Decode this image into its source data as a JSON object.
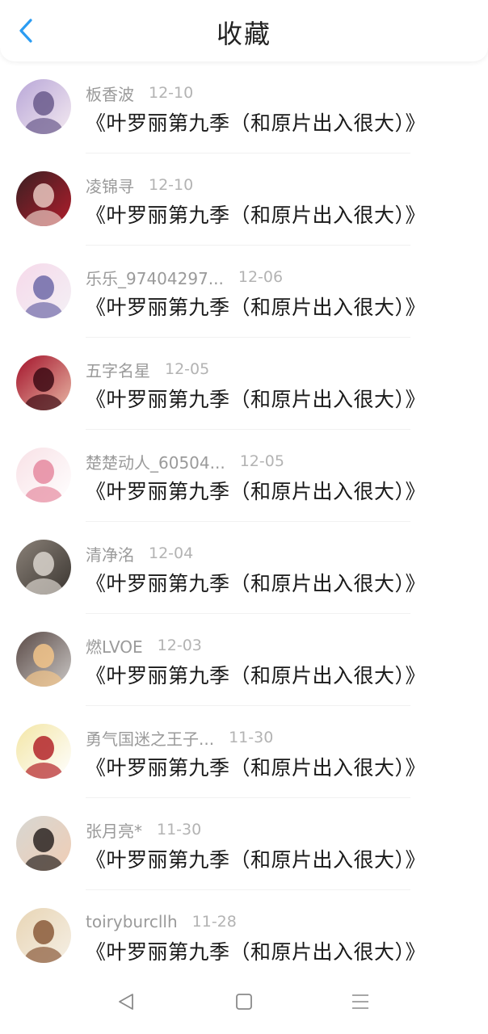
{
  "header": {
    "title": "收藏",
    "back_icon": "chevron-left-icon",
    "accent_color": "#2b9cf2"
  },
  "favorites": [
    {
      "username": "板香波",
      "date": "12-10",
      "title": "《叶罗丽第九季（和原片出入很大）》",
      "avatar_colors": [
        "#b9a7d8",
        "#6a5a8c",
        "#f3e9f0"
      ]
    },
    {
      "username": "凌锦寻",
      "date": "12-10",
      "title": "《叶罗丽第九季（和原片出入很大）》",
      "avatar_colors": [
        "#3a1f22",
        "#e8c7c0",
        "#b01e2c"
      ]
    },
    {
      "username": "乐乐_97404297...",
      "date": "12-06",
      "title": "《叶罗丽第九季（和原片出入很大）》",
      "avatar_colors": [
        "#f6d9ea",
        "#6f6aa8",
        "#f3f0f5"
      ]
    },
    {
      "username": "五字名星",
      "date": "12-05",
      "title": "《叶罗丽第九季（和原片出入很大）》",
      "avatar_colors": [
        "#a3122a",
        "#3d0b14",
        "#e8b6a4"
      ]
    },
    {
      "username": "楚楚动人_60504...",
      "date": "12-05",
      "title": "《叶罗丽第九季（和原片出入很大）》",
      "avatar_colors": [
        "#f8e1e6",
        "#e58aa0",
        "#ffffff"
      ]
    },
    {
      "username": "清净洺",
      "date": "12-04",
      "title": "《叶罗丽第九季（和原片出入很大）》",
      "avatar_colors": [
        "#8a8178",
        "#d9d3cc",
        "#3b3631"
      ]
    },
    {
      "username": "燃LVOE",
      "date": "12-03",
      "title": "《叶罗丽第九季（和原片出入很大）》",
      "avatar_colors": [
        "#5a4a46",
        "#f2c48a",
        "#c9c6c4"
      ]
    },
    {
      "username": "勇气国迷之王子...",
      "date": "11-30",
      "title": "《叶罗丽第九季（和原片出入很大）》",
      "avatar_colors": [
        "#f3e6a6",
        "#b3242a",
        "#ffffff"
      ]
    },
    {
      "username": "张月亮*",
      "date": "11-30",
      "title": "《叶罗丽第九季（和原片出入很大）》",
      "avatar_colors": [
        "#d7d7d2",
        "#2b2522",
        "#f0cdb5"
      ]
    },
    {
      "username": "toiryburcllh",
      "date": "11-28",
      "title": "《叶罗丽第九季（和原片出入很大）》",
      "avatar_colors": [
        "#e8d5b5",
        "#8a5a3a",
        "#f5efe4"
      ]
    }
  ],
  "navbar": {
    "back_icon": "triangle-back-icon",
    "home_icon": "square-home-icon",
    "menu_icon": "menu-lines-icon"
  }
}
